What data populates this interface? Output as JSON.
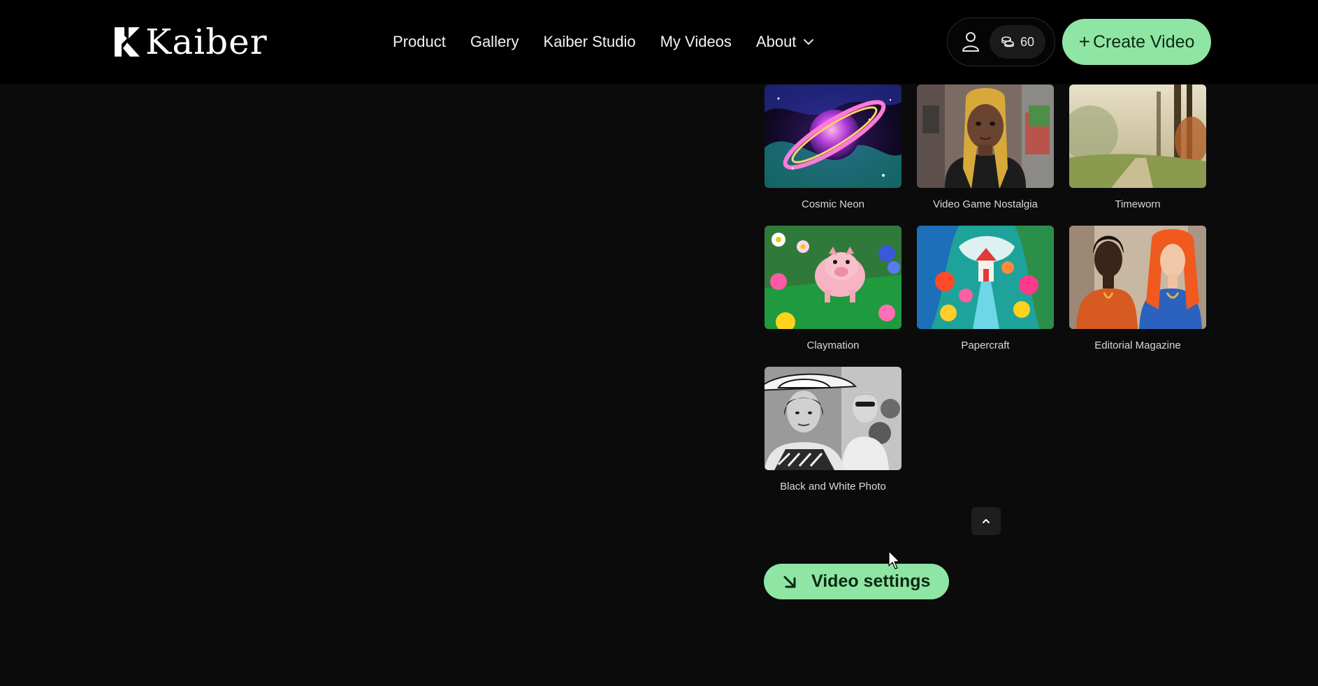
{
  "header": {
    "logo_text": "Kaiber",
    "nav": [
      {
        "label": "Product"
      },
      {
        "label": "Gallery"
      },
      {
        "label": "Kaiber Studio"
      },
      {
        "label": "My Videos"
      },
      {
        "label": "About",
        "has_dropdown": true
      }
    ],
    "credits": "60",
    "create_label": "Create Video",
    "create_plus": "+"
  },
  "styles": [
    {
      "label": "Cosmic Neon"
    },
    {
      "label": "Video Game Nostalgia"
    },
    {
      "label": "Timeworn"
    },
    {
      "label": "Claymation"
    },
    {
      "label": "Papercraft"
    },
    {
      "label": "Editorial Magazine"
    },
    {
      "label": "Black and White Photo"
    }
  ],
  "video_settings_label": "Video settings",
  "colors": {
    "accent": "#8fe6a4",
    "background": "#0b0b0b",
    "header": "#000000"
  },
  "icons": {
    "logo": "kaiber-logo-icon",
    "about_dropdown": "chevron-down-icon",
    "account": "user-icon",
    "credits": "coins-icon",
    "scroll_top": "chevron-up-icon",
    "video_settings": "arrow-down-right-icon"
  }
}
